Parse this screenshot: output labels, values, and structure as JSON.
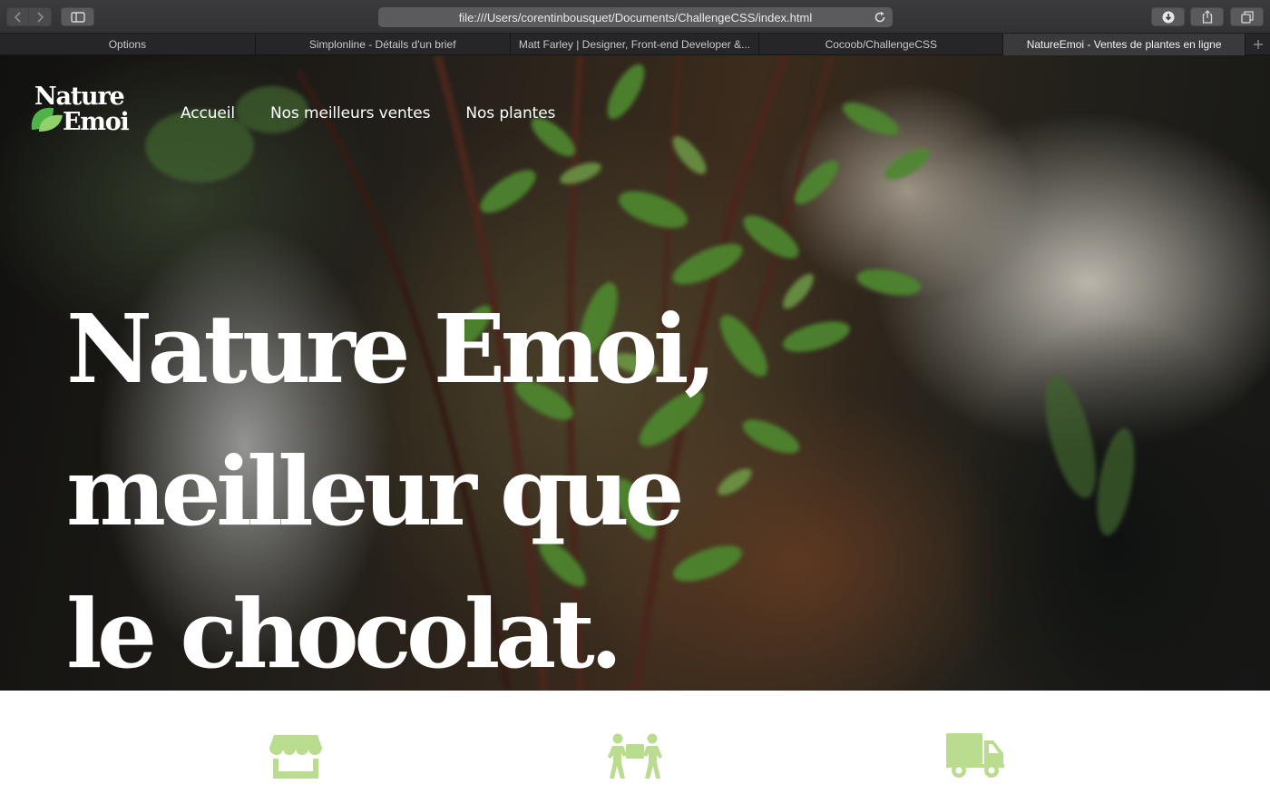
{
  "browser": {
    "url": "file:///Users/corentinbousquet/Documents/ChallengeCSS/index.html",
    "icons": {
      "back": "chevron-left-icon",
      "forward": "chevron-right-icon",
      "sidebar": "sidebar-icon",
      "reload": "reload-icon",
      "downloads": "download-icon",
      "share": "share-icon",
      "tabs_overview": "tabs-icon",
      "new_tab": "plus-icon"
    },
    "tabs": [
      {
        "label": "Options",
        "active": false
      },
      {
        "label": "Simplonline - Détails d'un brief",
        "active": false
      },
      {
        "label": "Matt Farley | Designer, Front-end Developer &...",
        "active": false
      },
      {
        "label": "Cocoob/ChallengeCSS",
        "active": false
      },
      {
        "label": "NatureEmoi - Ventes de plantes en ligne",
        "active": true
      }
    ]
  },
  "site": {
    "logo": {
      "line1": "Nature",
      "line2": "Emoi",
      "leaf_color": "#6cc04a"
    },
    "nav": [
      "Accueil",
      "Nos meilleurs ventes",
      "Nos plantes"
    ],
    "headline": [
      "Nature Emoi,",
      "meilleur que",
      "le chocolat."
    ],
    "features": [
      {
        "icon": "store-icon"
      },
      {
        "icon": "movers-icon"
      },
      {
        "icon": "delivery-truck-icon"
      }
    ],
    "accent_color": "#b9dc8e"
  }
}
